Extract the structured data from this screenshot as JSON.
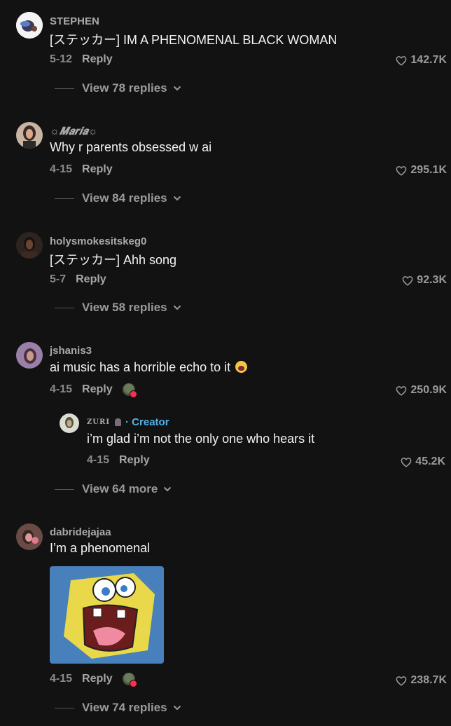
{
  "comments": [
    {
      "username": "STEPHEN",
      "text": "[ステッカー] IM A PHENOMENAL BLACK WOMAN",
      "date": "5-12",
      "reply": "Reply",
      "likes": "142.7K",
      "view_replies": "View 78 replies"
    },
    {
      "username": "☼𝑴𝒂𝒓𝒊𝒂☼",
      "text": "Why r parents obsessed w ai",
      "date": "4-15",
      "reply": "Reply",
      "likes": "295.1K",
      "view_replies": "View 84 replies"
    },
    {
      "username": "holysmokesitskeg0",
      "text": "[ステッカー] Ahh song",
      "date": "5-7",
      "reply": "Reply",
      "likes": "92.3K",
      "view_replies": "View 58 replies"
    },
    {
      "username": "jshanis3",
      "text": "ai music has a horrible echo to it",
      "date": "4-15",
      "reply": "Reply",
      "likes": "250.9K",
      "reply_thread": {
        "username": "ZURI",
        "creator_label": "· Creator",
        "text": "i’m glad i’m not the only one who hears it",
        "date": "4-15",
        "reply": "Reply",
        "likes": "45.2K"
      },
      "view_replies": "View 64 more"
    },
    {
      "username": "dabridejajaa",
      "text": "I’m a phenomenal",
      "date": "4-15",
      "reply": "Reply",
      "likes": "238.7K",
      "view_replies": "View 74 replies"
    }
  ],
  "icons": {
    "like": "heart-outline-icon",
    "expand": "chevron-down-icon"
  },
  "colors": {
    "background": "#121212",
    "creator_accent": "#53b3e8",
    "badge": "#fe2c55"
  }
}
